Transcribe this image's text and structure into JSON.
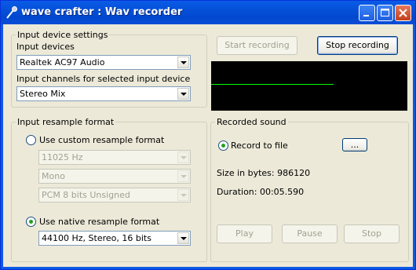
{
  "window": {
    "title": "wave crafter : Wav recorder"
  },
  "input_settings": {
    "legend": "Input device settings",
    "devices_label": "Input devices",
    "device_value": "Realtek AC97 Audio",
    "channels_label": "Input channels for selected input device",
    "channel_value": "Stereo Mix"
  },
  "buttons": {
    "start": "Start recording",
    "stop": "Stop recording"
  },
  "resample": {
    "legend": "Input resample format",
    "custom_label": "Use custom resample format",
    "custom_rate": "11025 Hz",
    "custom_channels": "Mono",
    "custom_format": "PCM 8 bits Unsigned",
    "native_label": "Use native resample format",
    "native_value": "44100 Hz, Stereo, 16 bits"
  },
  "recorded": {
    "legend": "Recorded sound",
    "record_to_file": "Record to file",
    "browse": "...",
    "size": "Size in bytes: 986120",
    "duration": "Duration: 00:05.590",
    "play": "Play",
    "pause": "Pause",
    "stop": "Stop"
  }
}
